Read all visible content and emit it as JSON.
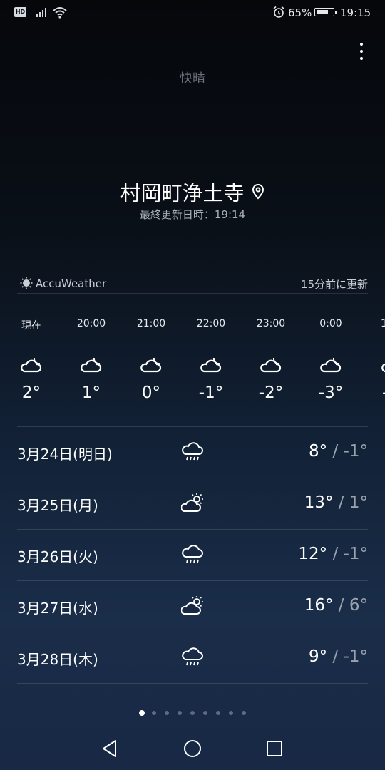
{
  "status_bar": {
    "hd_label": "HD",
    "battery_percent": "65%",
    "time": "19:15",
    "icons": [
      "signal-icon",
      "wifi-icon",
      "alarm-icon",
      "battery-charging-icon"
    ]
  },
  "header": {
    "faded_text": "快晴",
    "city": "村岡町浄土寺",
    "last_updated": "最終更新日時：19:14"
  },
  "provider": {
    "name": "AccuWeather",
    "updated_ago": "15分前に更新"
  },
  "hourly": [
    {
      "time": "現在",
      "icon": "partly-cloudy-night-icon",
      "temp": "2°"
    },
    {
      "time": "20:00",
      "icon": "partly-cloudy-night-icon",
      "temp": "1°"
    },
    {
      "time": "21:00",
      "icon": "partly-cloudy-night-icon",
      "temp": "0°"
    },
    {
      "time": "22:00",
      "icon": "partly-cloudy-night-icon",
      "temp": "-1°"
    },
    {
      "time": "23:00",
      "icon": "partly-cloudy-night-icon",
      "temp": "-2°"
    },
    {
      "time": "0:00",
      "icon": "partly-cloudy-night-icon",
      "temp": "-3°"
    },
    {
      "time": "1",
      "icon": "partly-cloudy-night-icon",
      "temp": "-"
    }
  ],
  "daily": [
    {
      "date": "3月24日(明日)",
      "icon": "rain-icon",
      "high": "8°",
      "low": "-1°"
    },
    {
      "date": "3月25日(月)",
      "icon": "partly-sunny-icon",
      "high": "13°",
      "low": "1°"
    },
    {
      "date": "3月26日(火)",
      "icon": "rain-icon",
      "high": "12°",
      "low": "-1°"
    },
    {
      "date": "3月27日(水)",
      "icon": "partly-sunny-icon",
      "high": "16°",
      "low": "6°"
    },
    {
      "date": "3月28日(木)",
      "icon": "rain-icon",
      "high": "9°",
      "low": "-1°"
    }
  ],
  "temp_separator": " / ",
  "page_indicator": {
    "count": 9,
    "active": 1
  },
  "nav_bar": {
    "icons": [
      "back-icon",
      "home-icon",
      "recents-icon"
    ]
  },
  "colors": {
    "text": "#ffffff",
    "muted": "#9aa3ae",
    "background_top": "#05070b",
    "background_bottom": "#182845"
  }
}
